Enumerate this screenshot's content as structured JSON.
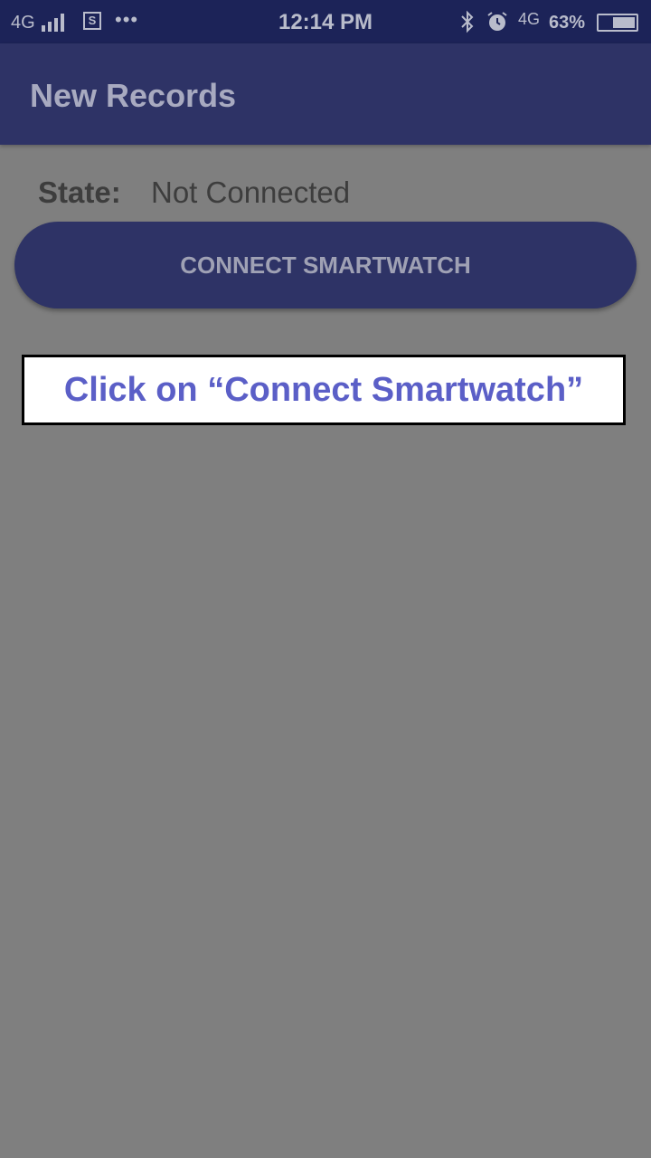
{
  "status_bar": {
    "network": "4G",
    "screenshot_icon_letter": "S",
    "more": "•••",
    "time": "12:14 PM",
    "network2": "4G",
    "battery_percent": "63%",
    "battery_level": 0.63,
    "icons": [
      "signal-icon",
      "screenshot-icon",
      "bluetooth-icon",
      "alarm-icon",
      "battery-icon"
    ]
  },
  "app_bar": {
    "title": "New Records"
  },
  "state": {
    "label": "State:",
    "value": "Not Connected"
  },
  "connect_button": {
    "label": "CONNECT SMARTWATCH"
  },
  "instruction": {
    "text": "Click on “Connect Smartwatch”"
  },
  "colors": {
    "overlay_background": "#7f7f7f",
    "status_bar": "#1c2358",
    "app_bar": "#2e3366",
    "button": "#2e3366",
    "instruction_text": "#5b5fc7"
  }
}
